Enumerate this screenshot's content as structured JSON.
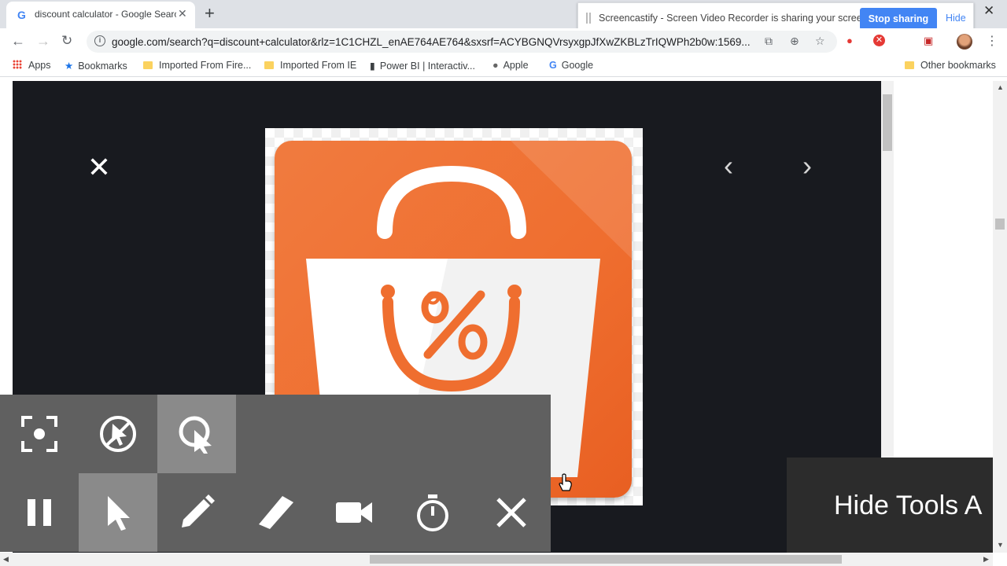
{
  "tab": {
    "title": "discount calculator - Google Search",
    "favicon": "G"
  },
  "share_bar": {
    "message": "Screencastify - Screen Video Recorder is sharing your screen.",
    "stop_label": "Stop sharing",
    "hide_label": "Hide"
  },
  "address_bar": {
    "url": "google.com/search?q=discount+calculator&rlz=1C1CHZL_enAE764AE764&sxsrf=ACYBGNQVrsyxgpJfXwZKBLzTrIQWPh2b0w:1569..."
  },
  "bookmarks": [
    {
      "label": "Apps",
      "icon": "apps-grid-icon"
    },
    {
      "label": "Bookmarks",
      "icon": "star-icon"
    },
    {
      "label": "Imported From Fire...",
      "icon": "folder-icon"
    },
    {
      "label": "Imported From IE",
      "icon": "folder-icon"
    },
    {
      "label": "Power BI | Interactiv...",
      "icon": "powerbi-icon"
    },
    {
      "label": "Apple",
      "icon": "apple-icon"
    },
    {
      "label": "Google",
      "icon": "google-icon"
    }
  ],
  "other_bookmarks": "Other bookmarks",
  "hide_tools_label": "Hide Tools  A",
  "colors": {
    "accent": "#4285f4",
    "tile_orange": "#ef6e2f",
    "viewer_bg": "#181a1f",
    "tools_bg": "#606060"
  }
}
